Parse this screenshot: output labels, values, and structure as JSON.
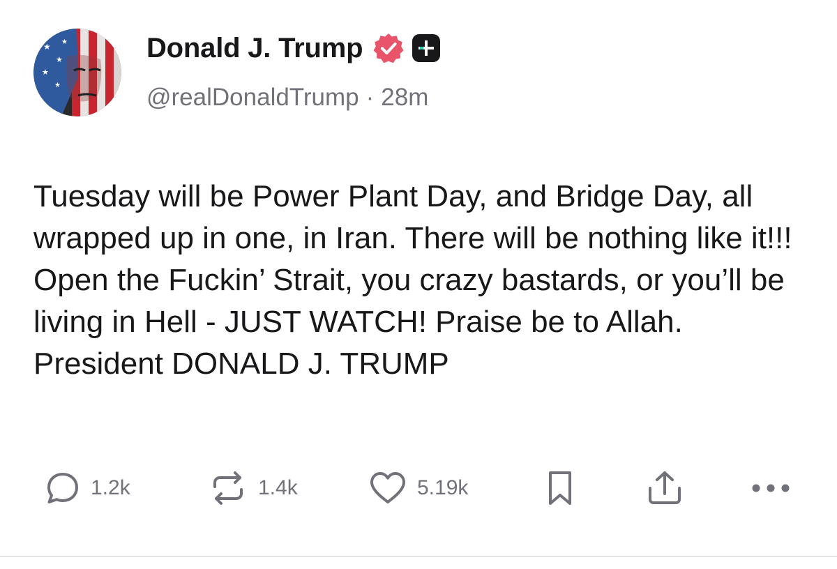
{
  "post": {
    "author": {
      "display_name": "Donald J. Trump",
      "handle": "@realDonaldTrump",
      "verified_icon": "verified-check-icon",
      "subscription_icon": "plus-badge-icon"
    },
    "separator": "·",
    "time_ago": "28m",
    "body": "Tuesday will be Power Plant Day, and Bridge Day, all wrapped up in one, in Iran. There will be nothing like it!!! Open the Fuckin’ Strait, you crazy bastards, or you’ll be living in Hell - JUST WATCH! Praise be to Allah. President DONALD J. TRUMP",
    "actions": {
      "replies": "1.2k",
      "reposts": "1.4k",
      "likes": "5.19k"
    }
  },
  "colors": {
    "text": "#18181b",
    "muted": "#71717a",
    "verified": "#e8556b",
    "badge_bg": "#18181b",
    "badge_accent": "#27d3a3",
    "divider": "#e4e4e7"
  }
}
